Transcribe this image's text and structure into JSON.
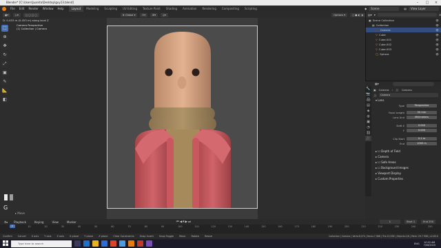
{
  "titlebar": {
    "title": "Blender* [C:\\Users\\Juanita\\Desktop\\guy13.blend]"
  },
  "menus": [
    "File",
    "Edit",
    "Render",
    "Window",
    "Help"
  ],
  "workspaces": [
    "Layout",
    "Modeling",
    "Sculpting",
    "UV Editing",
    "Texture Paint",
    "Shading",
    "Animation",
    "Rendering",
    "Compositing",
    "Scripting"
  ],
  "active_workspace": "Layout",
  "topbar_right": {
    "scene": "Scene",
    "view_layer": "View Layer"
  },
  "header2": {
    "transform": "Global",
    "options": "Options"
  },
  "operator_status": "D: 0.453 m (0.453 m) along local Z",
  "viewport": {
    "camera_line1": "Camera Perspective",
    "camera_line2": "(1) Collection | Camera",
    "g_key": "G",
    "move_label": "Move"
  },
  "outliner": {
    "rows": [
      {
        "label": "Scene Collection",
        "indent": 0,
        "selected": false
      },
      {
        "label": "Collection",
        "indent": 1,
        "selected": false
      },
      {
        "label": "Camera",
        "indent": 2,
        "selected": true
      },
      {
        "label": "Cube",
        "indent": 2,
        "selected": false
      },
      {
        "label": "Cube.001",
        "indent": 2,
        "selected": false
      },
      {
        "label": "Cube.002",
        "indent": 2,
        "selected": false
      },
      {
        "label": "Cube.003",
        "indent": 2,
        "selected": false
      },
      {
        "label": "Sphere",
        "indent": 2,
        "selected": false
      }
    ]
  },
  "properties": {
    "breadcrumb_obj": "Camera",
    "breadcrumb_data": "Camera",
    "data_name": "Camera",
    "lens_section": "Lens",
    "type_label": "Type",
    "type_value": "Perspective",
    "focal_label": "Focal Length",
    "focal_value": "50 mm",
    "lensunit_label": "Lens Unit",
    "lensunit_value": "Millimeters",
    "shiftx_label": "Shift X",
    "shiftx_value": "0.000",
    "shifty_label": "Y",
    "shifty_value": "0.000",
    "clipstart_label": "Clip Start",
    "clipstart_value": "0.1 m",
    "end_label": "End",
    "end_value": "1000 m",
    "sections": [
      "Depth of Field",
      "Camera",
      "Safe Areas",
      "Background Images",
      "Viewport Display",
      "Custom Properties"
    ]
  },
  "timeline": {
    "menus": [
      "Playback",
      "Keying",
      "View",
      "Marker"
    ],
    "current_frame": "1",
    "start_label": "Start",
    "start": "1",
    "end_label": "End",
    "end": "250",
    "ticks": [
      "0",
      "10",
      "20",
      "30",
      "40",
      "50",
      "60",
      "70",
      "80",
      "90",
      "100",
      "110",
      "120",
      "130",
      "140",
      "150",
      "160",
      "170",
      "180",
      "190",
      "200",
      "210",
      "220",
      "230",
      "240",
      "250"
    ]
  },
  "statusbar": {
    "items": [
      "Confirm",
      "Cancel",
      "X axis",
      "Y axis",
      "Z axis",
      "X plane",
      "Y plane",
      "Z plane",
      "Clear Constraints",
      "Snap Invert",
      "Snap Toggle",
      "Move",
      "Rotate",
      "Resize"
    ],
    "right": "Collection | Camera | Verts:8,074 | Faces:7,988 | Tris:15,936 | Objects:1/6 | Mem: 29.7 MiB | v2.83.0"
  },
  "taskbar": {
    "search_placeholder": "Type here to search",
    "lang": "ENG",
    "time": "10:22 AM",
    "date": "7/06/2020"
  },
  "colors": {
    "accent": "#4772b3",
    "blender_orange": "#e87d0d",
    "figure_skin": "#d9a982",
    "jacket": "#c9575c",
    "sweater": "#a88b5f"
  }
}
